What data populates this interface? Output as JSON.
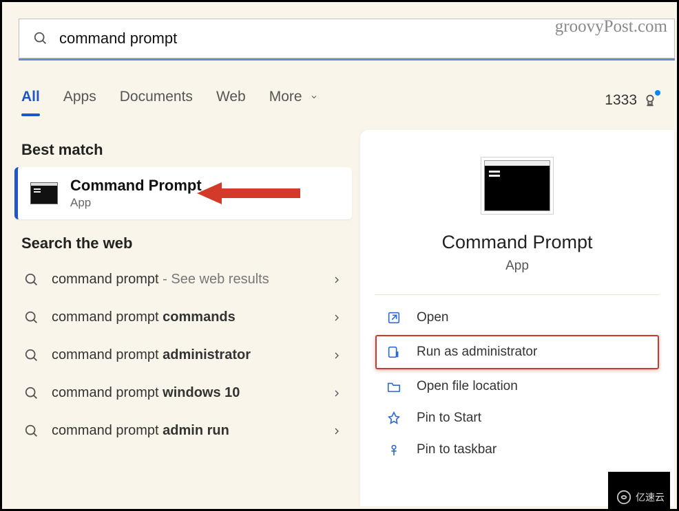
{
  "search": {
    "query": "command prompt"
  },
  "watermark": "groovyPost.com",
  "tabs": {
    "items": [
      {
        "label": "All",
        "active": true
      },
      {
        "label": "Apps"
      },
      {
        "label": "Documents"
      },
      {
        "label": "Web"
      }
    ],
    "more_label": "More"
  },
  "points": {
    "value": "1333"
  },
  "best_match": {
    "section_label": "Best match",
    "title": "Command Prompt",
    "subtitle": "App"
  },
  "web_section_label": "Search the web",
  "web_results": [
    {
      "prefix": "command prompt",
      "bold": "",
      "suffix": " - See web results"
    },
    {
      "prefix": "command prompt ",
      "bold": "commands",
      "suffix": ""
    },
    {
      "prefix": "command prompt ",
      "bold": "administrator",
      "suffix": ""
    },
    {
      "prefix": "command prompt ",
      "bold": "windows 10",
      "suffix": ""
    },
    {
      "prefix": "command prompt ",
      "bold": "admin run",
      "suffix": ""
    }
  ],
  "details": {
    "title": "Command Prompt",
    "subtitle": "App",
    "actions": {
      "open": "Open",
      "run_admin": "Run as administrator",
      "open_loc": "Open file location",
      "pin_start": "Pin to Start",
      "pin_taskbar": "Pin to taskbar"
    }
  },
  "bottom_badge": "亿速云"
}
